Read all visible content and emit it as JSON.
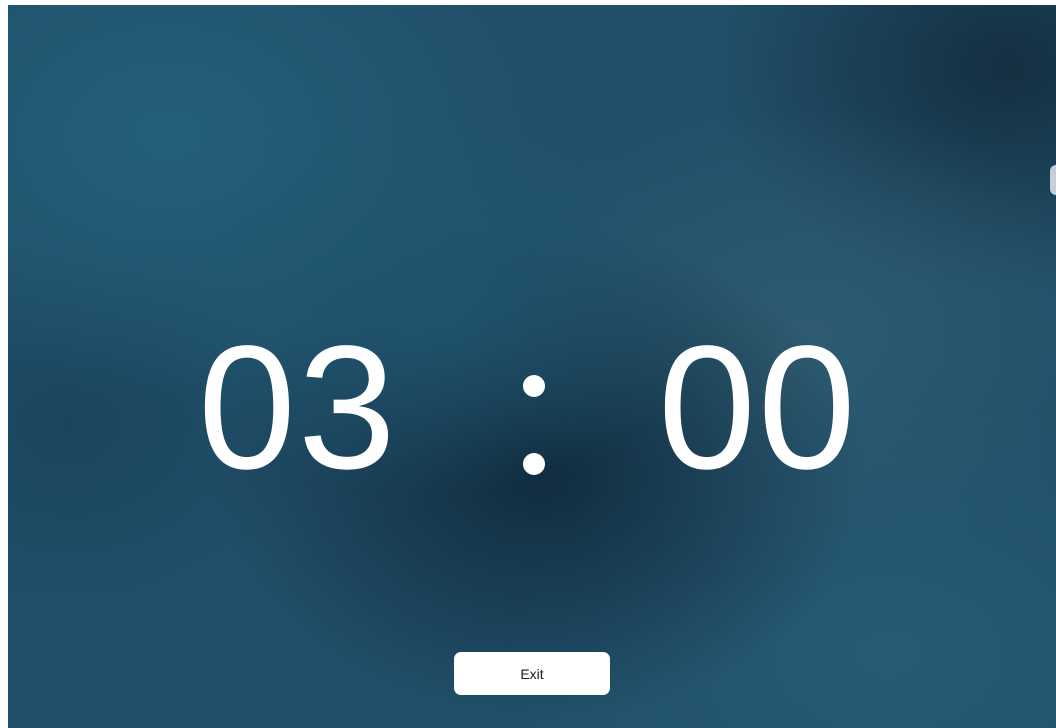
{
  "timer": {
    "minutes": "03",
    "seconds": "00"
  },
  "actions": {
    "exit_label": "Exit"
  },
  "colors": {
    "background": "#21506a",
    "text": "#ffffff",
    "button_background": "#ffffff",
    "button_text": "#1c1c1c"
  }
}
